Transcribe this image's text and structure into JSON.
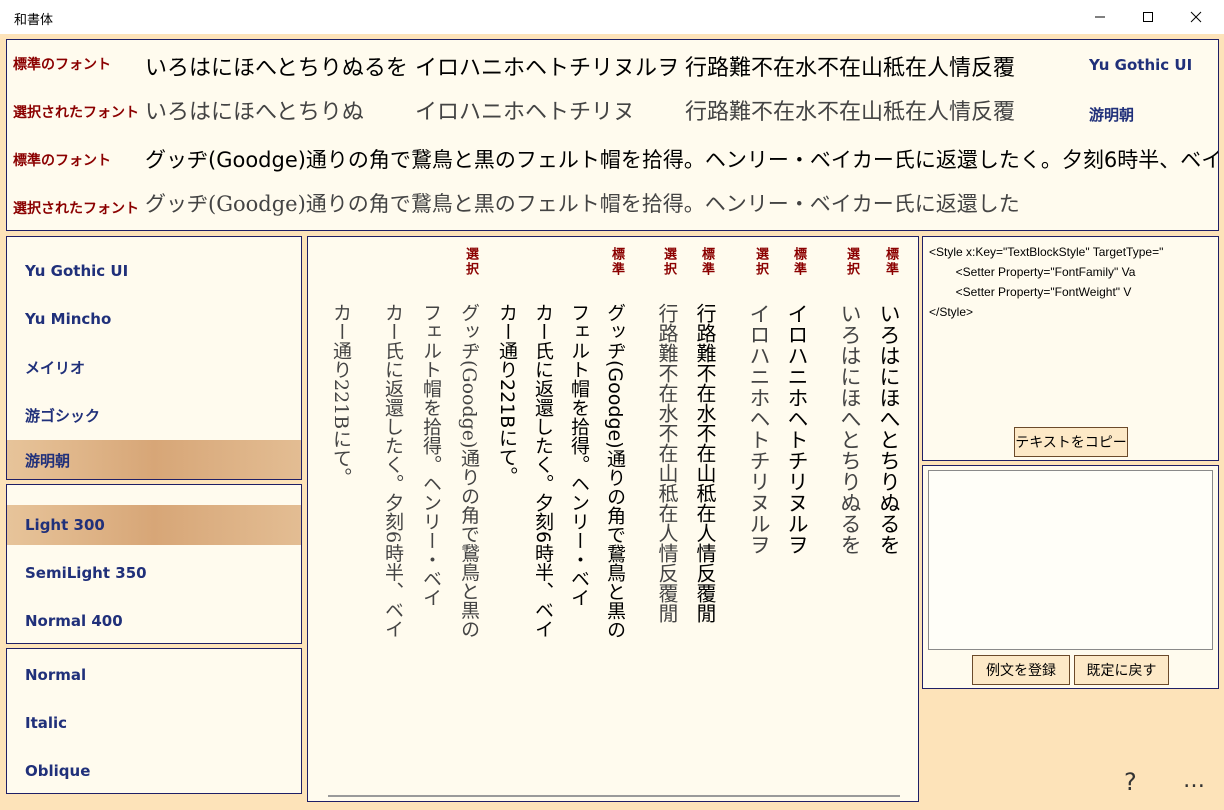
{
  "window": {
    "title": "和書体"
  },
  "compare": {
    "standard_label": "標準のフォント",
    "selected_label": "選択されたフォント",
    "kana_standard": "いろはにほへとちりぬるを",
    "katakana_standard": "イロハニホヘトチリヌルヲ",
    "kanji_standard": "行路難不在水不在山秪在人情反覆",
    "kana_selected": "いろはにほへとちりぬ",
    "katakana_selected": "イロハニホヘトチリヌ",
    "kanji_selected": "行路難不在水不在山秪在人情反覆",
    "standard_font_name": "Yu Gothic UI",
    "selected_font_name": "游明朝",
    "sentence_standard": "グッヂ(Goodge)通りの角で鵞鳥と黒のフェルト帽を拾得。ヘンリー・ベイカー氏に返還したく。夕刻6時半、ベイ",
    "sentence_selected": "グッヂ(Goodge)通りの角で鵞鳥と黒のフェルト帽を拾得。ヘンリー・ベイカー氏に返還した"
  },
  "font_list": [
    "Yu Gothic UI",
    "Yu Mincho",
    "メイリオ",
    "游ゴシック",
    "游明朝"
  ],
  "weight_list": [
    "Light  300",
    "SemiLight  350",
    "Normal  400"
  ],
  "style_list": [
    "Normal",
    "Italic",
    "Oblique"
  ],
  "vertical": {
    "tag_standard": "標準",
    "tag_selected": "選択",
    "col_kana_std": "いろはにほへとちりぬるを",
    "col_kana_sel": "いろはにほへとちりぬるを",
    "col_kata_std": "イロハニホヘトチリヌルヲ",
    "col_kata_sel": "イロハニホヘトチリヌルヲ",
    "col_kanji_std": "行路難不在水不在山秪在人情反覆閒",
    "col_kanji_sel": "行路難不在水不在山秪在人情反覆閒",
    "col_sent_std_1": "グッヂ(Goodge)通りの角で鵞鳥と黒の",
    "col_sent_std_2": "フェルト帽を拾得。ヘンリー・ベイ",
    "col_sent_std_3": "カー氏に返還したく。夕刻6時半、ベイ",
    "col_sent_std_4": "カー通り221Bにて。",
    "col_sent_sel_1": "グッヂ(Goodge)通りの角で鵞鳥と黒の",
    "col_sent_sel_2": "フェルト帽を拾得。ヘンリー・ベイ",
    "col_sent_sel_3": "カー氏に返還したく。夕刻6時半、ベイ",
    "col_sent_sel_4": "カー通り221Bにて。"
  },
  "code": {
    "line1": "<Style x:Key=\"TextBlockStyle\" TargetType=\"",
    "line2": "        <Setter Property=\"FontFamily\" Va",
    "line3": "        <Setter Property=\"FontWeight\" V",
    "line4": "</Style>"
  },
  "buttons": {
    "copy": "テキストをコピー",
    "register": "例文を登録",
    "reset": "既定に戻す"
  },
  "footer": {
    "help": "?",
    "more": "…"
  },
  "colors": {
    "background": "#fde3b9",
    "panel": "#fffbee",
    "label_red": "#8b0000",
    "label_blue": "#20307a",
    "selection": "#d7a677"
  }
}
